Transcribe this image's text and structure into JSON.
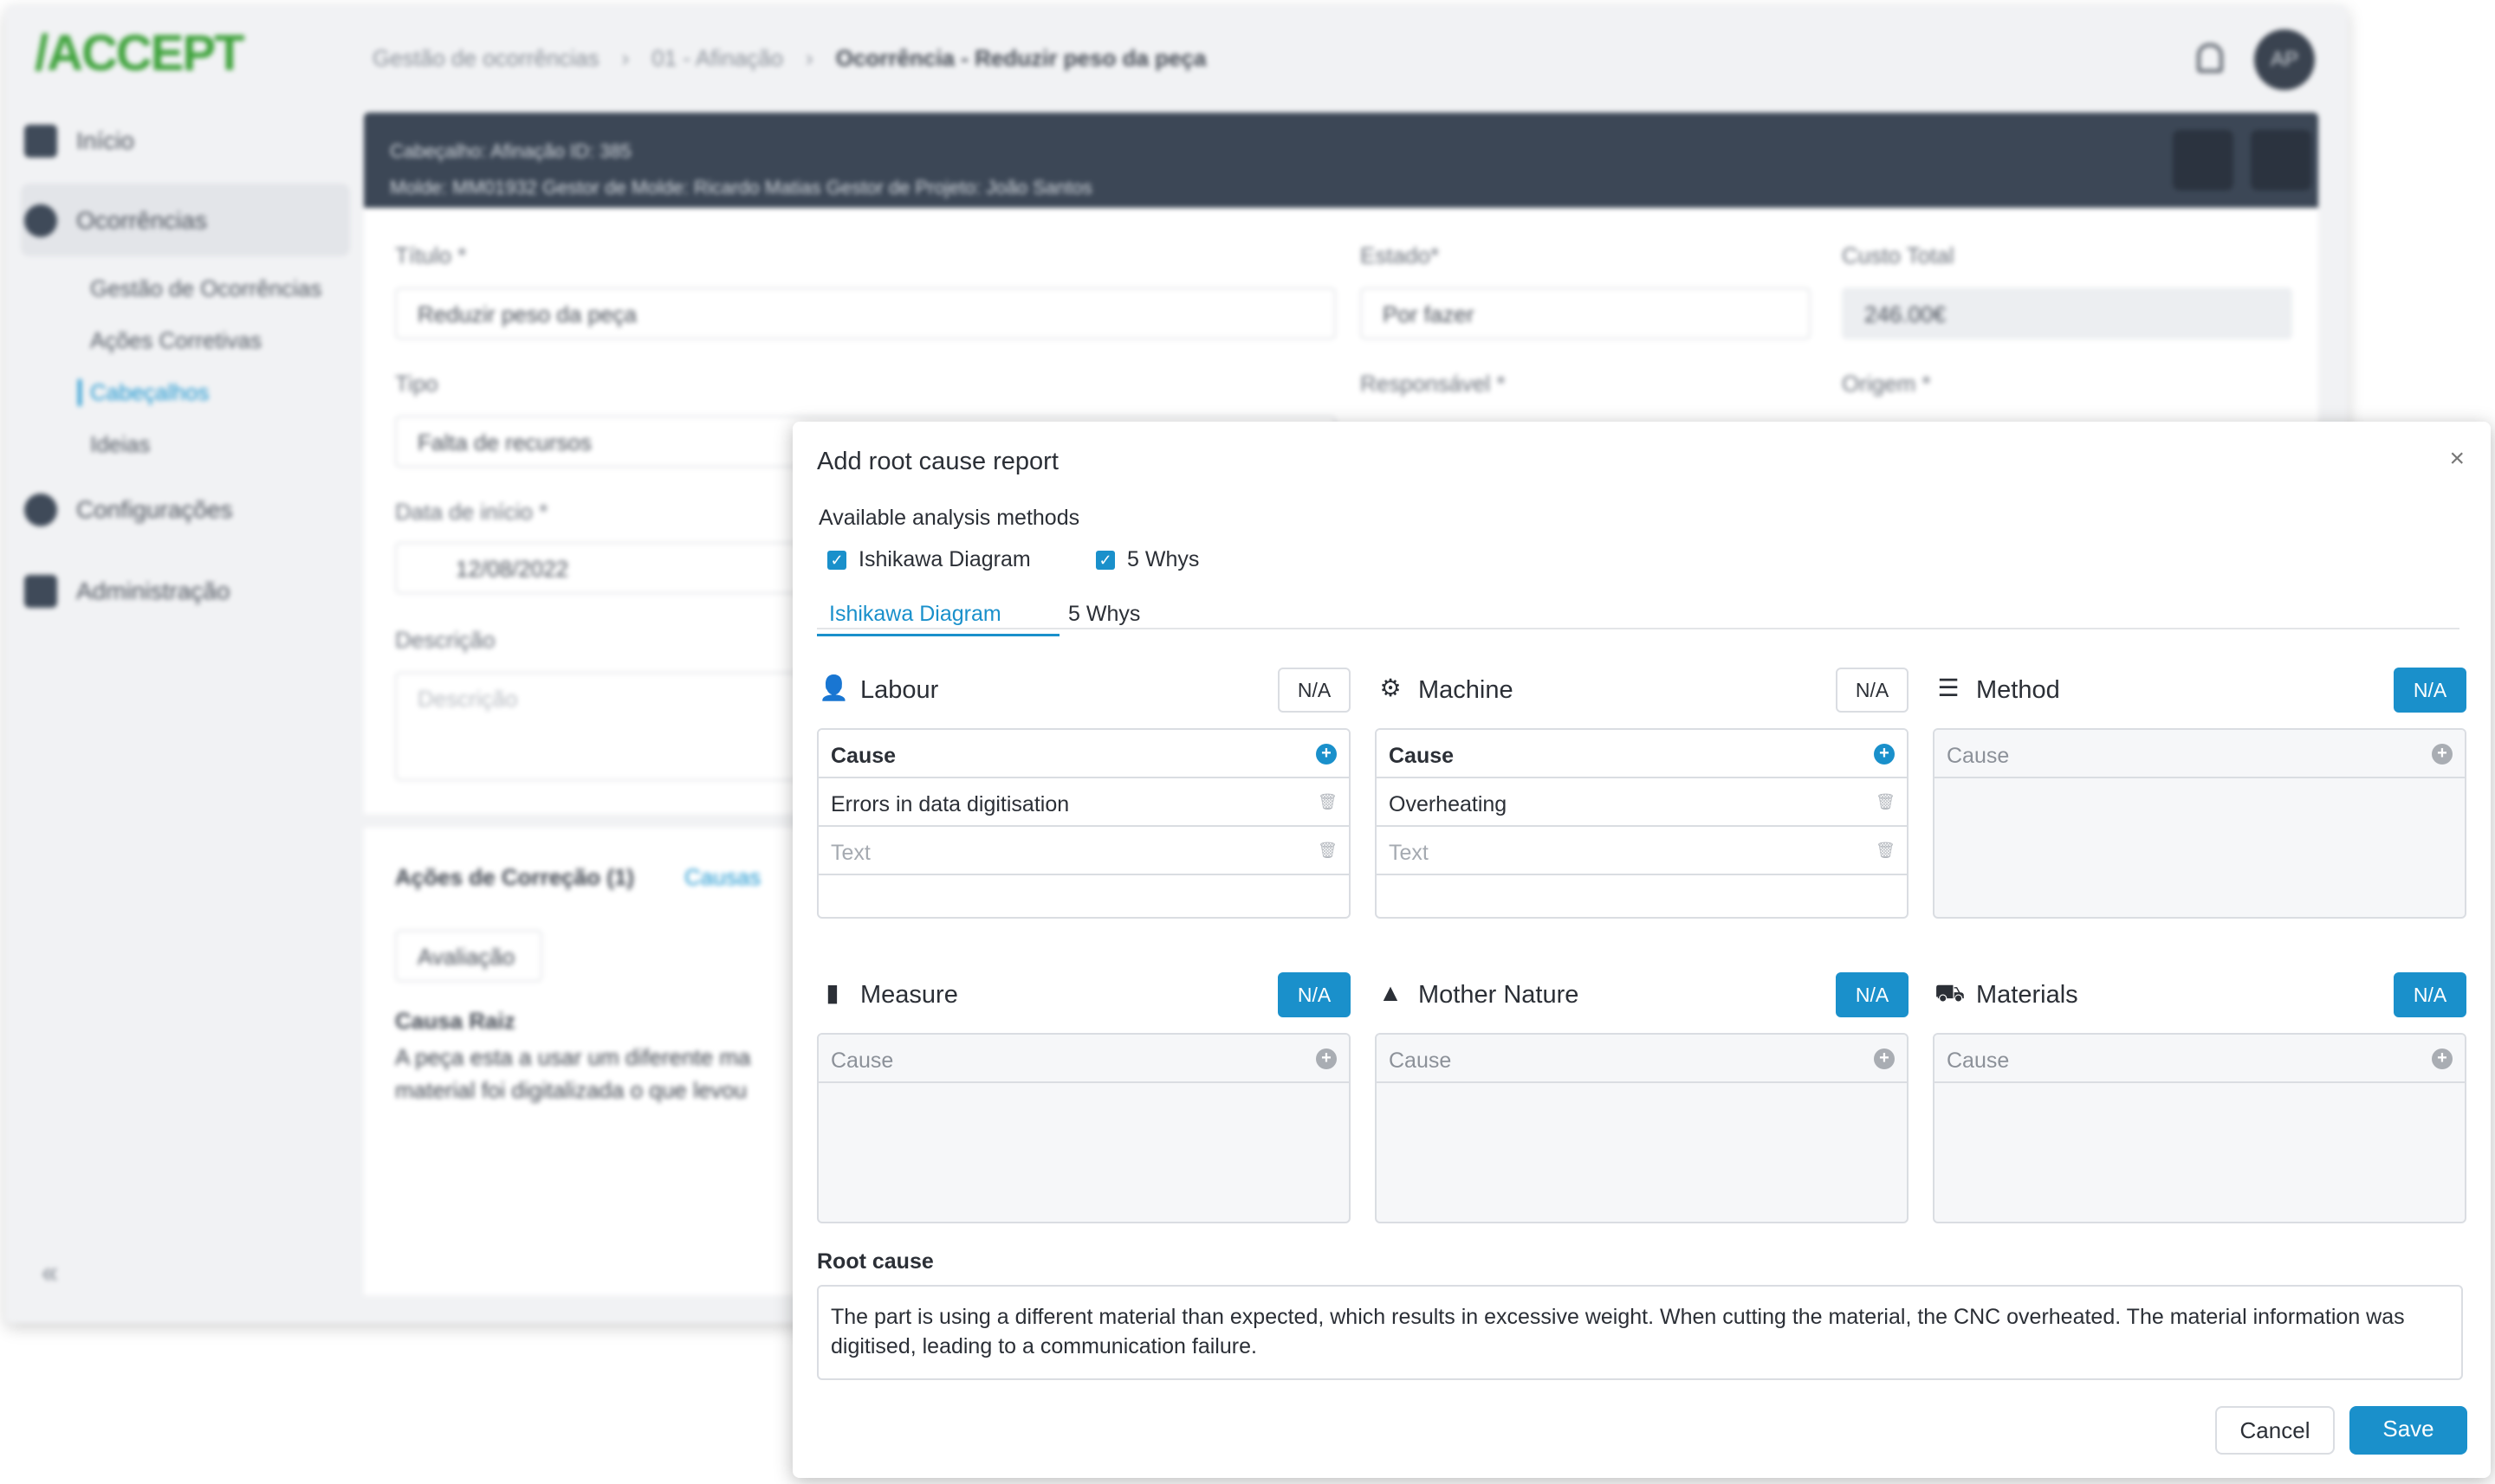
{
  "app": {
    "logo": "ACCEPT",
    "nav": {
      "inicio": "Início",
      "ocorrencias": "Ocorrências",
      "sub": [
        "Gestão de Ocorrências",
        "Ações Corretivas",
        "Cabeçalhos",
        "Ideias"
      ],
      "configuracoes": "Configurações",
      "administracao": "Administração"
    },
    "breadcrumb": [
      "Gestão de ocorrências",
      "01 - Afinação",
      "Ocorrência - Reduzir peso da peça"
    ],
    "avatar": "AP",
    "header": {
      "line1": "Cabeçalho: Afinação   ID: 385",
      "line2": "Molde: MM01932   Gestor de Molde: Ricardo Matias   Gestor de Projeto: João Santos"
    },
    "form": {
      "titulo_label": "Título *",
      "titulo_value": "Reduzir peso da peça",
      "estado_label": "Estado*",
      "estado_value": "Por fazer",
      "custo_label": "Custo Total",
      "custo_value": "246.00€",
      "tipo_label": "Tipo",
      "tipo_value": "Falta de recursos",
      "responsavel_label": "Responsável *",
      "origem_label": "Origem *",
      "data_label": "Data de início *",
      "data_value": "12/08/2022",
      "descricao_label": "Descrição",
      "descricao_placeholder": "Descrição"
    },
    "lower": {
      "tab1": "Ações de Correção (1)",
      "tab2": "Causas",
      "avaliacao": "Avaliação",
      "causa_raiz": "Causa Raiz",
      "causa_text1": "A peça esta a usar um diferente ma",
      "causa_text2": "material foi digitalizada o que levou"
    }
  },
  "modal": {
    "title": "Add root cause report",
    "close": "×",
    "methods_label": "Available analysis methods",
    "methods": [
      "Ishikawa Diagram",
      "5 Whys"
    ],
    "tabs": [
      "Ishikawa Diagram",
      "5 Whys"
    ],
    "categories": [
      {
        "name": "Labour",
        "icon": "person-icon",
        "na": "N/A",
        "na_active": false,
        "header": "Cause",
        "rows": [
          "Errors in data digitisation"
        ],
        "placeholder": "Text"
      },
      {
        "name": "Machine",
        "icon": "robot-arm-icon",
        "na": "N/A",
        "na_active": false,
        "header": "Cause",
        "rows": [
          "Overheating"
        ],
        "placeholder": "Text"
      },
      {
        "name": "Method",
        "icon": "checklist-icon",
        "na": "N/A",
        "na_active": true,
        "header": "Cause",
        "rows": [],
        "placeholder": ""
      },
      {
        "name": "Measure",
        "icon": "bar-chart-icon",
        "na": "N/A",
        "na_active": true,
        "header": "Cause",
        "rows": [],
        "placeholder": ""
      },
      {
        "name": "Mother Nature",
        "icon": "tree-icon",
        "na": "N/A",
        "na_active": true,
        "header": "Cause",
        "rows": [],
        "placeholder": ""
      },
      {
        "name": "Materials",
        "icon": "pallet-jack-icon",
        "na": "N/A",
        "na_active": true,
        "header": "Cause",
        "rows": [],
        "placeholder": ""
      }
    ],
    "root_cause_label": "Root cause",
    "root_cause_text": "The part is using a different material than expected, which results in excessive weight. When cutting the material, the CNC overheated. The material information was digitised, leading to a communication failure.",
    "cancel": "Cancel",
    "save": "Save",
    "colors": {
      "accent": "#1a90cb",
      "border": "#dadde2"
    }
  }
}
